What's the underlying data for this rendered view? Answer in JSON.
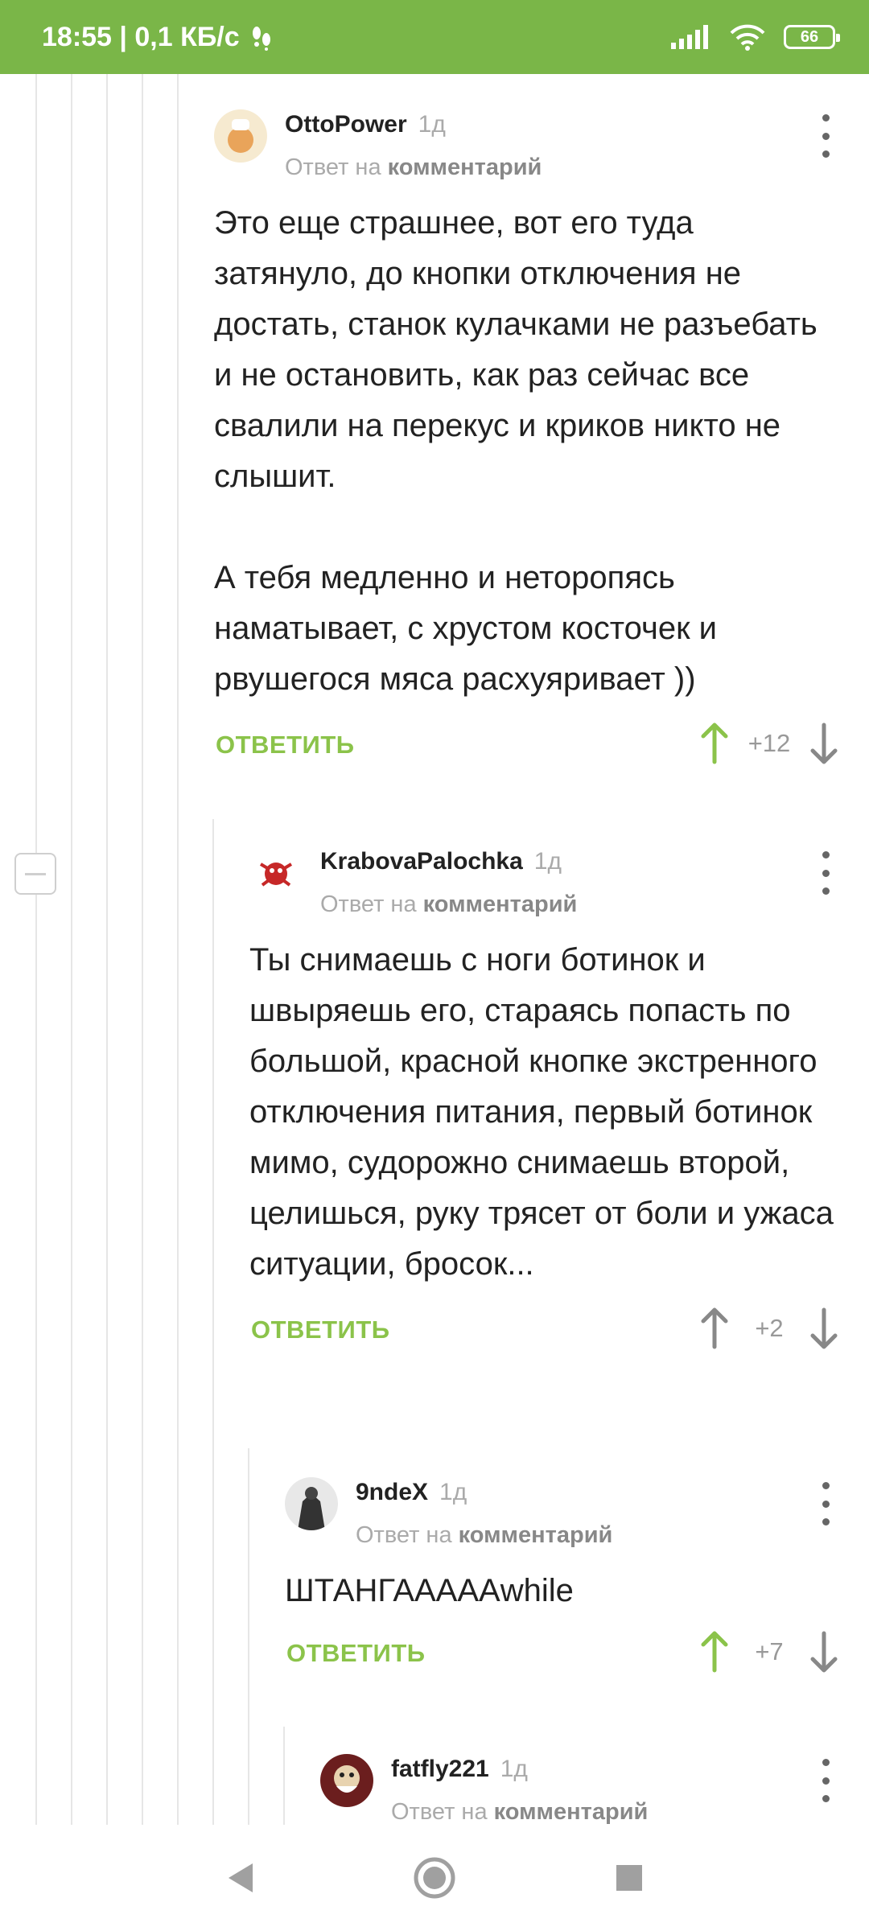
{
  "status_bar": {
    "time_speed": "18:55 | 0,1 КБ/с",
    "battery": "66"
  },
  "comments": [
    {
      "author": "OttoPower",
      "time": "1д",
      "reply_prefix": "Ответ на",
      "reply_target": "комментарий",
      "text": "Это еще страшнее, вот его туда затянуло, до кнопки отключения не достать, станок кулачками не разъебать и не остановить, как раз сейчас все свалили на перекус и криков никто не слышит.\n\nА тебя медленно и неторопясь наматывает, с хрустом косточек и рвушегося мяса расхуяривает ))",
      "reply_label": "ОТВЕТИТЬ",
      "score": "+12",
      "upvoted": true
    },
    {
      "author": "KrabovaPalochka",
      "time": "1д",
      "reply_prefix": "Ответ на",
      "reply_target": "комментарий",
      "text": "Ты снимаешь с ноги ботинок и швыряешь его, стараясь попасть по большой, красной кнопке экстренного отключения питания, первый ботинок мимо, судорожно снимаешь второй, целишься, руку трясет от боли и ужаса ситуации, бросок...",
      "reply_label": "ОТВЕТИТЬ",
      "score": "+2",
      "upvoted": false
    },
    {
      "author": "9ndeX",
      "time": "1д",
      "reply_prefix": "Ответ на",
      "reply_target": "комментарий",
      "text": "ШТАНГАААААwhile",
      "reply_label": "ОТВЕТИТЬ",
      "score": "+7",
      "upvoted": true
    },
    {
      "author": "fatfly221",
      "time": "1д",
      "reply_prefix": "Ответ на",
      "reply_target": "комментарий"
    }
  ],
  "colors": {
    "accent": "#8bc34a",
    "status_bar": "#7ab648",
    "muted": "#aaaaaa"
  }
}
